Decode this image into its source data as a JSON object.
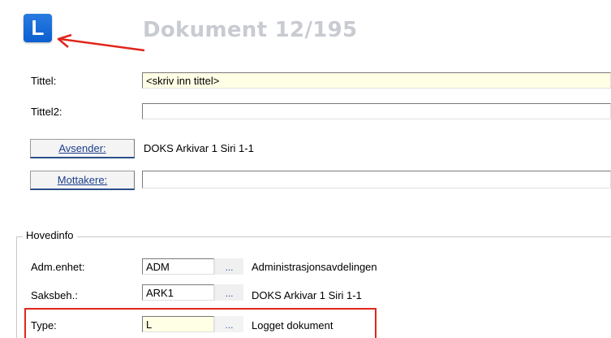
{
  "header": {
    "logo_letter": "L",
    "doc_title": "Dokument 12/195"
  },
  "fields": {
    "tittel": {
      "label": "Tittel:",
      "value": "<skriv inn tittel>"
    },
    "tittel2": {
      "label": "Tittel2:",
      "value": ""
    },
    "avsender": {
      "button": "Avsender:",
      "value": "DOKS Arkivar 1 Siri 1-1"
    },
    "mottakere": {
      "button": "Mottakere:",
      "value": ""
    }
  },
  "hovedinfo": {
    "title": "Hovedinfo",
    "adm": {
      "label": "Adm.enhet:",
      "code": "ADM",
      "ellipsis": "...",
      "desc": "Administrasjonsavdelingen"
    },
    "saksbeh": {
      "label": "Saksbeh.:",
      "code": "ARK1",
      "ellipsis": "...",
      "desc": "DOKS Arkivar 1 Siri 1-1"
    },
    "type": {
      "label": "Type:",
      "code": "L",
      "ellipsis": "...",
      "desc": "Logget dokument"
    }
  },
  "colors": {
    "logo": "#0a5fcf",
    "highlight": "#e0261b",
    "input_yellow": "#ffffe6",
    "title_grey": "#c9cbd2"
  }
}
